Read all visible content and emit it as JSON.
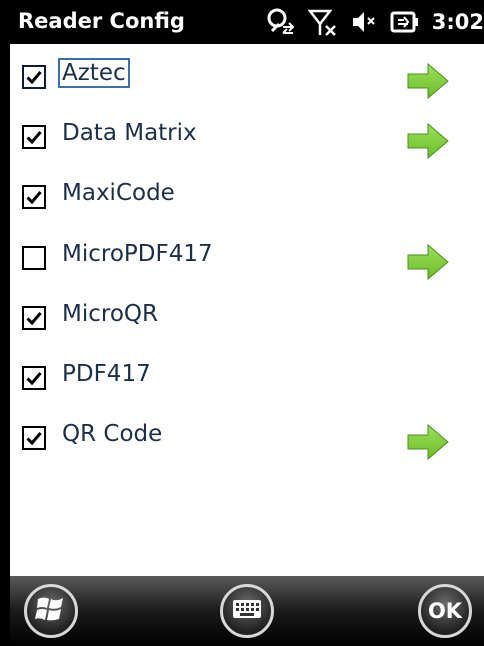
{
  "statusbar": {
    "title": "Reader Config",
    "clock": "3:02",
    "icons": [
      "connectivity-icon",
      "signal-off-icon",
      "speaker-muted-icon",
      "battery-charging-icon"
    ]
  },
  "symbologies": [
    {
      "label": "Aztec",
      "checked": true,
      "focused": true,
      "has_settings": true
    },
    {
      "label": "Data Matrix",
      "checked": true,
      "focused": false,
      "has_settings": true
    },
    {
      "label": "MaxiCode",
      "checked": true,
      "focused": false,
      "has_settings": false
    },
    {
      "label": "MicroPDF417",
      "checked": false,
      "focused": false,
      "has_settings": true
    },
    {
      "label": "MicroQR",
      "checked": true,
      "focused": false,
      "has_settings": false
    },
    {
      "label": "PDF417",
      "checked": true,
      "focused": false,
      "has_settings": false
    },
    {
      "label": "QR Code",
      "checked": true,
      "focused": false,
      "has_settings": true
    }
  ],
  "softkeys": {
    "start": "windows-logo-icon",
    "keyboard": "keyboard-icon",
    "ok_label": "OK"
  },
  "colors": {
    "arrow": "#6cbd2a",
    "label_text": "#1c2f4a",
    "focus_outline": "#3a6fb0"
  }
}
